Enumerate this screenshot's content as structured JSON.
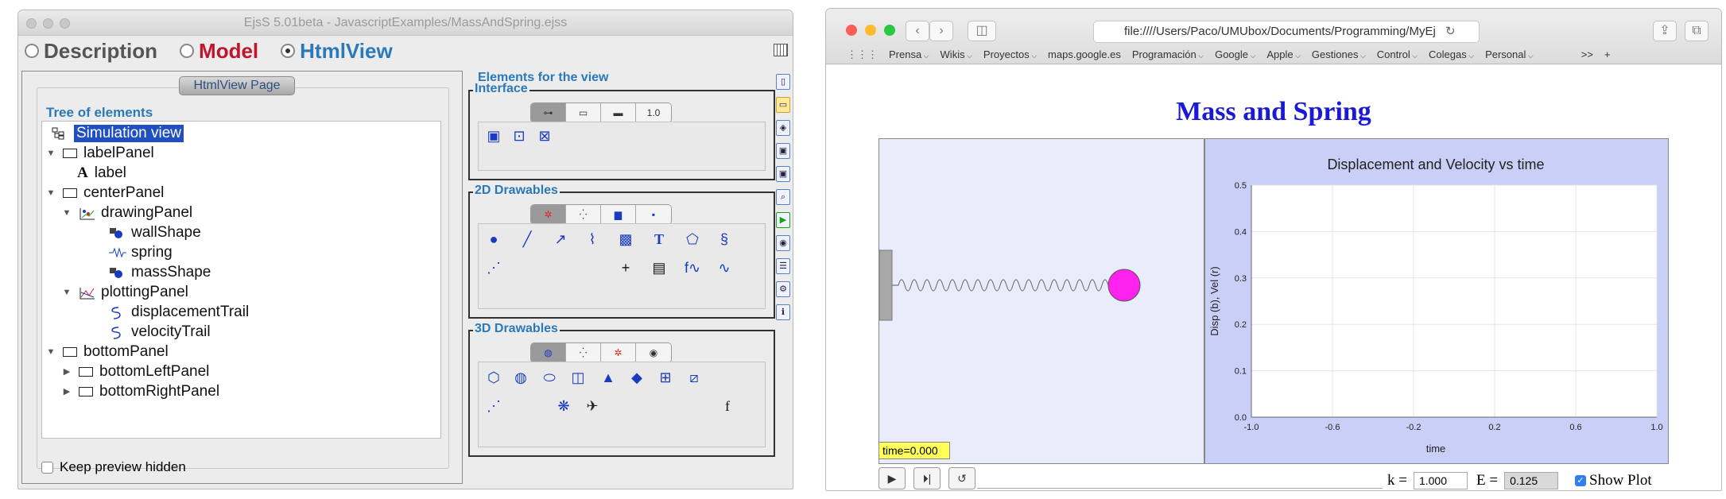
{
  "left_window": {
    "title": "EjsS 5.01beta - JavascriptExamples/MassAndSpring.ejss",
    "modes": [
      {
        "label": "Description",
        "color": "#555555",
        "selected": false
      },
      {
        "label": "Model",
        "color": "#c0152c",
        "selected": false
      },
      {
        "label": "HtmlView",
        "color": "#2b79b8",
        "selected": true
      }
    ],
    "page_button": "HtmlView Page",
    "tree_label": "Tree of elements",
    "tree": [
      {
        "label": "Simulation view",
        "icon": "simulation-view-icon",
        "selected": true
      },
      {
        "label": "labelPanel",
        "icon": "panel-icon",
        "toggle": "expanded"
      },
      {
        "label": "label",
        "icon": "label-A-icon"
      },
      {
        "label": "centerPanel",
        "icon": "panel-icon",
        "toggle": "expanded"
      },
      {
        "label": "drawingPanel",
        "icon": "drawing-panel-icon",
        "toggle": "expanded"
      },
      {
        "label": "wallShape",
        "icon": "shape-icon"
      },
      {
        "label": "spring",
        "icon": "spring-icon"
      },
      {
        "label": "massShape",
        "icon": "shape-icon"
      },
      {
        "label": "plottingPanel",
        "icon": "plotting-panel-icon",
        "toggle": "expanded"
      },
      {
        "label": "displacementTrail",
        "icon": "trail-icon"
      },
      {
        "label": "velocityTrail",
        "icon": "trail-icon"
      },
      {
        "label": "bottomPanel",
        "icon": "panel-icon",
        "toggle": "expanded"
      },
      {
        "label": "bottomLeftPanel",
        "icon": "panel-icon",
        "toggle": "collapsed"
      },
      {
        "label": "bottomRightPanel",
        "icon": "panel-icon",
        "toggle": "collapsed"
      }
    ],
    "keep_preview": "Keep preview hidden",
    "palette_header": "Elements for the view",
    "groups": [
      {
        "label": "Interface"
      },
      {
        "label": "2D Drawables"
      },
      {
        "label": "3D Drawables"
      }
    ],
    "interface_seg_icons": [
      "tree-icon",
      "window-icon",
      "bar-icon",
      "number-field-icon"
    ],
    "interface_seg_numfield": "1.0",
    "text_tool_glyph": "T",
    "function_tool_glyph": "f∿",
    "surface_tool_glyph": "f"
  },
  "right_window": {
    "url": "file:////Users/Paco/UMUbox/Documents/Programming/MyEj",
    "bookmarks": [
      "Prensa",
      "Wikis",
      "Proyectos",
      "maps.google.es",
      "Programación",
      "Google",
      "Apple",
      "Gestiones",
      "Control",
      "Colegas",
      "Personal"
    ],
    "overflow_label": ">>",
    "app_title": "Mass and Spring",
    "time_label": "time=0.000",
    "k_label": "k =",
    "k_value": "1.000",
    "e_label": "E =",
    "e_value": "0.125",
    "show_plot_label": "Show Plot",
    "colors": {
      "mass": "#ff22ee",
      "sim_bg": "#e8ecfb",
      "plot_bg": "#c9cff6",
      "title": "#1a1ad6"
    }
  },
  "chart_data": {
    "type": "line",
    "title": "Displacement and Velocity vs time",
    "xlabel": "time",
    "ylabel": "Disp (b), Vel (r)",
    "xlim": [
      -1.0,
      1.0
    ],
    "ylim": [
      0.0,
      0.5
    ],
    "xticks": [
      "-1.0",
      "-0.6",
      "-0.2",
      "0.2",
      "0.6",
      "1.0"
    ],
    "yticks": [
      "0.0",
      "0.1",
      "0.2",
      "0.3",
      "0.4",
      "0.5"
    ],
    "series": [],
    "grid": true
  }
}
